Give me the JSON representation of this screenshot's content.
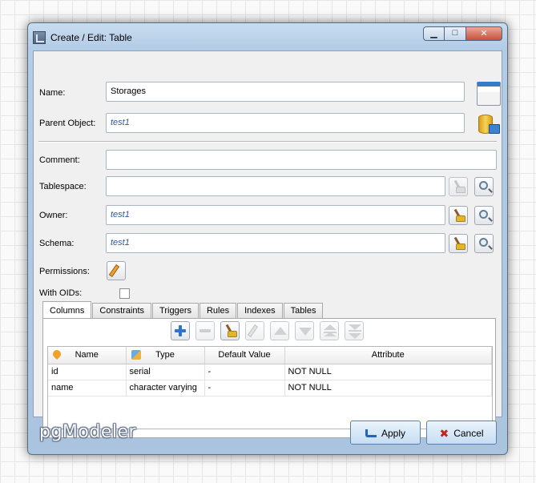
{
  "window": {
    "title": "Create / Edit: Table",
    "minimize_glyph": "▁",
    "maximize_glyph": "□",
    "close_glyph": "✕"
  },
  "form": {
    "name_label": "Name:",
    "name_value": "Storages",
    "parent_label": "Parent Object:",
    "parent_value": "test1",
    "comment_label": "Comment:",
    "comment_value": "",
    "tablespace_label": "Tablespace:",
    "tablespace_value": "",
    "owner_label": "Owner:",
    "owner_value": "test1",
    "schema_label": "Schema:",
    "schema_value": "test1",
    "permissions_label": "Permissions:",
    "with_oids_label": "With OIDs:",
    "with_oids_checked": false
  },
  "tabs": [
    "Columns",
    "Constraints",
    "Triggers",
    "Rules",
    "Indexes",
    "Tables"
  ],
  "active_tab": "Columns",
  "columns_table": {
    "headers": [
      "Name",
      "Type",
      "Default Value",
      "Attribute"
    ],
    "rows": [
      [
        "id",
        "serial",
        "-",
        "NOT NULL"
      ],
      [
        "name",
        "character varying",
        "-",
        "NOT NULL"
      ]
    ]
  },
  "footer": {
    "logo_text": "pgModeler",
    "apply_label": "Apply",
    "cancel_label": "Cancel"
  },
  "icons": {
    "table": "table-icon",
    "parent": "database-icon",
    "clear": "broom-icon",
    "select": "magnifier-icon",
    "edit": "pencil-icon"
  },
  "colors": {
    "accent": "#2c5aa0",
    "title_bar": "#b4cde6",
    "close_button": "#c7503b"
  }
}
